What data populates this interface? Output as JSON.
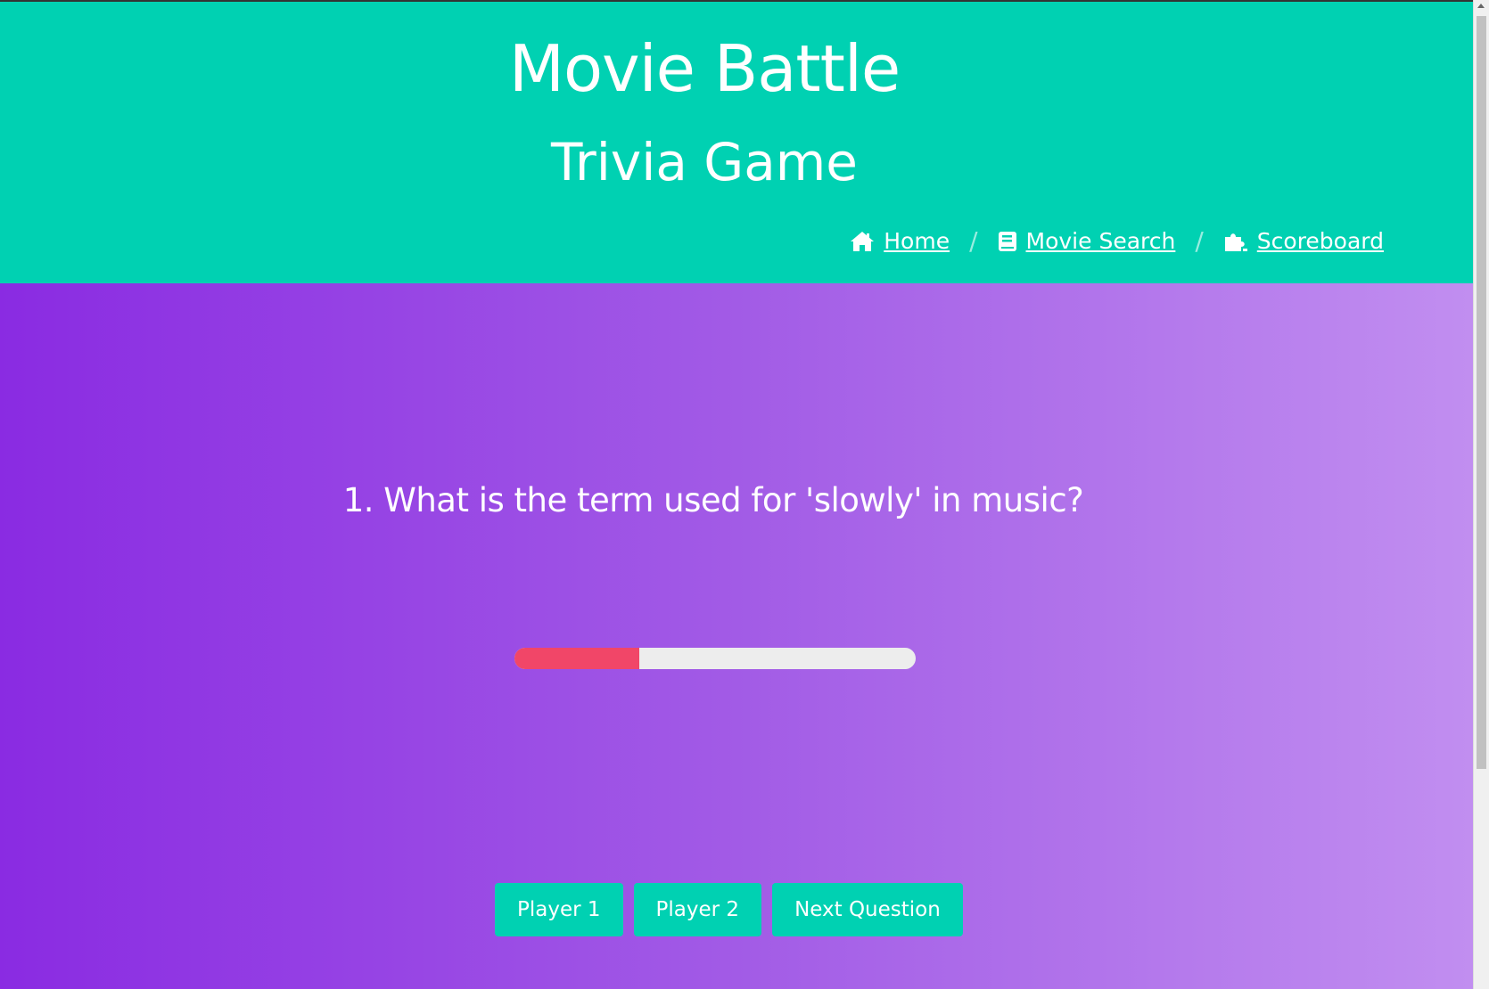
{
  "header": {
    "title": "Movie Battle",
    "subtitle": "Trivia Game",
    "bg_color": "#00d1b2"
  },
  "breadcrumb": [
    {
      "label": "Home",
      "icon": "home-icon"
    },
    {
      "label": "Movie Search",
      "icon": "book-icon"
    },
    {
      "label": "Scoreboard",
      "icon": "puzzle-icon"
    }
  ],
  "breadcrumb_separator": "/",
  "question": {
    "text": "1. What is the term used for 'slowly' in music?"
  },
  "timer": {
    "progress_percent": 31,
    "fill_color": "#f14668"
  },
  "buttons": {
    "player1": "Player 1",
    "player2": "Player 2",
    "next": "Next Question"
  }
}
